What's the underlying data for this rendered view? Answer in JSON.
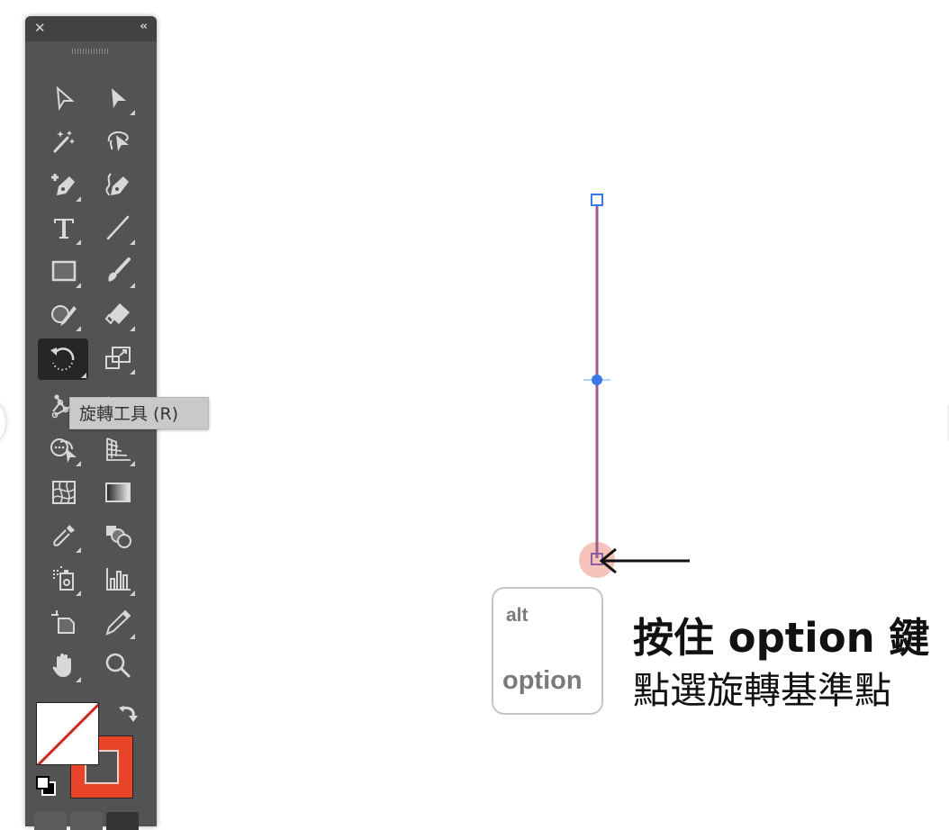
{
  "toolbar": {
    "close_label": "✕",
    "collapse_label": "‹‹",
    "tools": [
      {
        "name": "selection-tool",
        "col": 0,
        "row": 0
      },
      {
        "name": "direct-selection-tool",
        "col": 1,
        "row": 0
      },
      {
        "name": "magic-wand-tool",
        "col": 0,
        "row": 1
      },
      {
        "name": "lasso-tool",
        "col": 1,
        "row": 1
      },
      {
        "name": "pen-tool",
        "col": 0,
        "row": 2
      },
      {
        "name": "curvature-tool",
        "col": 1,
        "row": 2
      },
      {
        "name": "type-tool",
        "col": 0,
        "row": 3
      },
      {
        "name": "line-segment-tool",
        "col": 1,
        "row": 3
      },
      {
        "name": "rectangle-tool",
        "col": 0,
        "row": 4
      },
      {
        "name": "paintbrush-tool",
        "col": 1,
        "row": 4
      },
      {
        "name": "shaper-tool",
        "col": 0,
        "row": 5
      },
      {
        "name": "eraser-tool",
        "col": 1,
        "row": 5
      },
      {
        "name": "rotate-tool",
        "col": 0,
        "row": 6,
        "active": true
      },
      {
        "name": "scale-tool",
        "col": 1,
        "row": 6
      },
      {
        "name": "puppet-warp-tool",
        "col": 0,
        "row": 7
      },
      {
        "name": "free-transform-tool",
        "col": 1,
        "row": 7
      },
      {
        "name": "shape-builder-tool",
        "col": 0,
        "row": 8
      },
      {
        "name": "perspective-grid-tool",
        "col": 1,
        "row": 8
      },
      {
        "name": "mesh-tool",
        "col": 0,
        "row": 9
      },
      {
        "name": "gradient-tool",
        "col": 1,
        "row": 9
      },
      {
        "name": "eyedropper-tool",
        "col": 0,
        "row": 10
      },
      {
        "name": "blend-tool",
        "col": 1,
        "row": 10
      },
      {
        "name": "symbol-sprayer-tool",
        "col": 0,
        "row": 11
      },
      {
        "name": "column-graph-tool",
        "col": 1,
        "row": 11
      },
      {
        "name": "artboard-tool",
        "col": 0,
        "row": 12
      },
      {
        "name": "pencil-tool",
        "col": 1,
        "row": 12
      },
      {
        "name": "hand-tool",
        "col": 0,
        "row": 13
      },
      {
        "name": "zoom-tool",
        "col": 1,
        "row": 13
      }
    ],
    "fill_color": "none",
    "stroke_color": "#e8442a"
  },
  "tooltip": {
    "text": "旋轉工具 (R)"
  },
  "canvas": {
    "path_color": "#a05a8c",
    "anchor_color": "#3b78e7",
    "origin_highlight_color": "#f2b8b0"
  },
  "key": {
    "alt_label": "alt",
    "option_label": "option"
  },
  "caption": {
    "line1": "按住 option 鍵",
    "line2": "點選旋轉基準點"
  }
}
